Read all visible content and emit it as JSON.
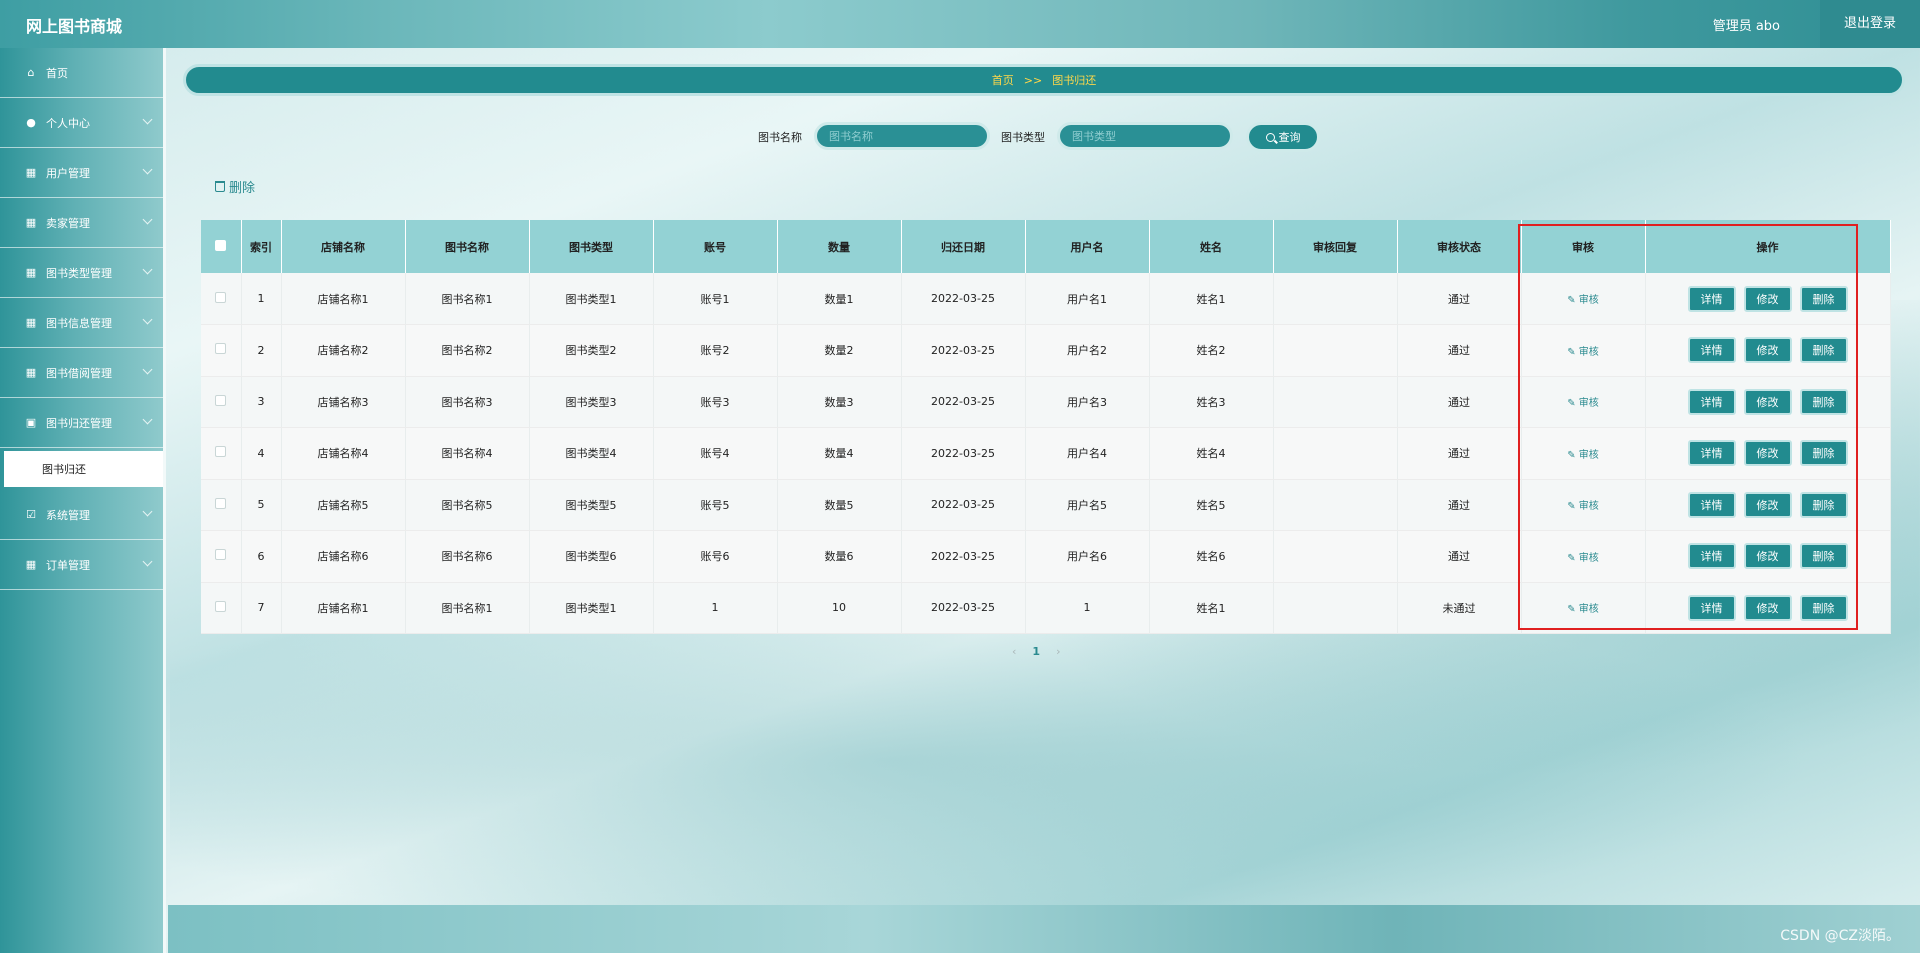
{
  "header": {
    "app_title": "网上图书商城",
    "admin_label": "管理员 abo",
    "logout_label": "退出登录"
  },
  "sidebar": {
    "items": [
      {
        "label": "首页",
        "icon": "home-icon",
        "has_children": false
      },
      {
        "label": "个人中心",
        "icon": "user-icon",
        "has_children": true
      },
      {
        "label": "用户管理",
        "icon": "grid-icon",
        "has_children": true
      },
      {
        "label": "卖家管理",
        "icon": "grid-icon",
        "has_children": true
      },
      {
        "label": "图书类型管理",
        "icon": "grid-icon",
        "has_children": true
      },
      {
        "label": "图书信息管理",
        "icon": "grid-icon",
        "has_children": true
      },
      {
        "label": "图书借阅管理",
        "icon": "grid-icon",
        "has_children": true
      },
      {
        "label": "图书归还管理",
        "icon": "calendar-icon",
        "has_children": true
      },
      {
        "label": "系统管理",
        "icon": "checklist-icon",
        "has_children": true
      },
      {
        "label": "订单管理",
        "icon": "grid-icon",
        "has_children": true
      }
    ],
    "active_sub": "图书归还"
  },
  "breadcrumb": {
    "home": "首页",
    "sep": ">>",
    "current": "图书归还"
  },
  "search": {
    "name_label": "图书名称",
    "name_placeholder": "图书名称",
    "type_label": "图书类型",
    "type_placeholder": "图书类型",
    "button_label": "查询"
  },
  "toolbar": {
    "delete_label": "删除"
  },
  "table": {
    "headers": [
      "索引",
      "店铺名称",
      "图书名称",
      "图书类型",
      "账号",
      "数量",
      "归还日期",
      "用户名",
      "姓名",
      "审核回复",
      "审核状态",
      "审核",
      "操作"
    ],
    "rows": [
      {
        "index": "1",
        "shop": "店铺名称1",
        "book": "图书名称1",
        "type": "图书类型1",
        "account": "账号1",
        "qty": "数量1",
        "date": "2022-03-25",
        "username": "用户名1",
        "name": "姓名1",
        "reply": "",
        "status": "通过"
      },
      {
        "index": "2",
        "shop": "店铺名称2",
        "book": "图书名称2",
        "type": "图书类型2",
        "account": "账号2",
        "qty": "数量2",
        "date": "2022-03-25",
        "username": "用户名2",
        "name": "姓名2",
        "reply": "",
        "status": "通过"
      },
      {
        "index": "3",
        "shop": "店铺名称3",
        "book": "图书名称3",
        "type": "图书类型3",
        "account": "账号3",
        "qty": "数量3",
        "date": "2022-03-25",
        "username": "用户名3",
        "name": "姓名3",
        "reply": "",
        "status": "通过"
      },
      {
        "index": "4",
        "shop": "店铺名称4",
        "book": "图书名称4",
        "type": "图书类型4",
        "account": "账号4",
        "qty": "数量4",
        "date": "2022-03-25",
        "username": "用户名4",
        "name": "姓名4",
        "reply": "",
        "status": "通过"
      },
      {
        "index": "5",
        "shop": "店铺名称5",
        "book": "图书名称5",
        "type": "图书类型5",
        "account": "账号5",
        "qty": "数量5",
        "date": "2022-03-25",
        "username": "用户名5",
        "name": "姓名5",
        "reply": "",
        "status": "通过"
      },
      {
        "index": "6",
        "shop": "店铺名称6",
        "book": "图书名称6",
        "type": "图书类型6",
        "account": "账号6",
        "qty": "数量6",
        "date": "2022-03-25",
        "username": "用户名6",
        "name": "姓名6",
        "reply": "",
        "status": "通过"
      },
      {
        "index": "7",
        "shop": "店铺名称1",
        "book": "图书名称1",
        "type": "图书类型1",
        "account": "1",
        "qty": "10",
        "date": "2022-03-25",
        "username": "1",
        "name": "姓名1",
        "reply": "",
        "status": "未通过"
      }
    ],
    "audit_label": "审核",
    "actions": {
      "detail": "详情",
      "edit": "修改",
      "delete": "删除"
    }
  },
  "pagination": {
    "current_page": "1",
    "prev": "‹",
    "next": "›"
  },
  "watermark": "CSDN @CZ淡陌。",
  "colors": {
    "primary": "#228b8f",
    "header_row": "#93d2d4",
    "breadcrumb_text": "#ffd84a",
    "highlight": "#e02020"
  }
}
